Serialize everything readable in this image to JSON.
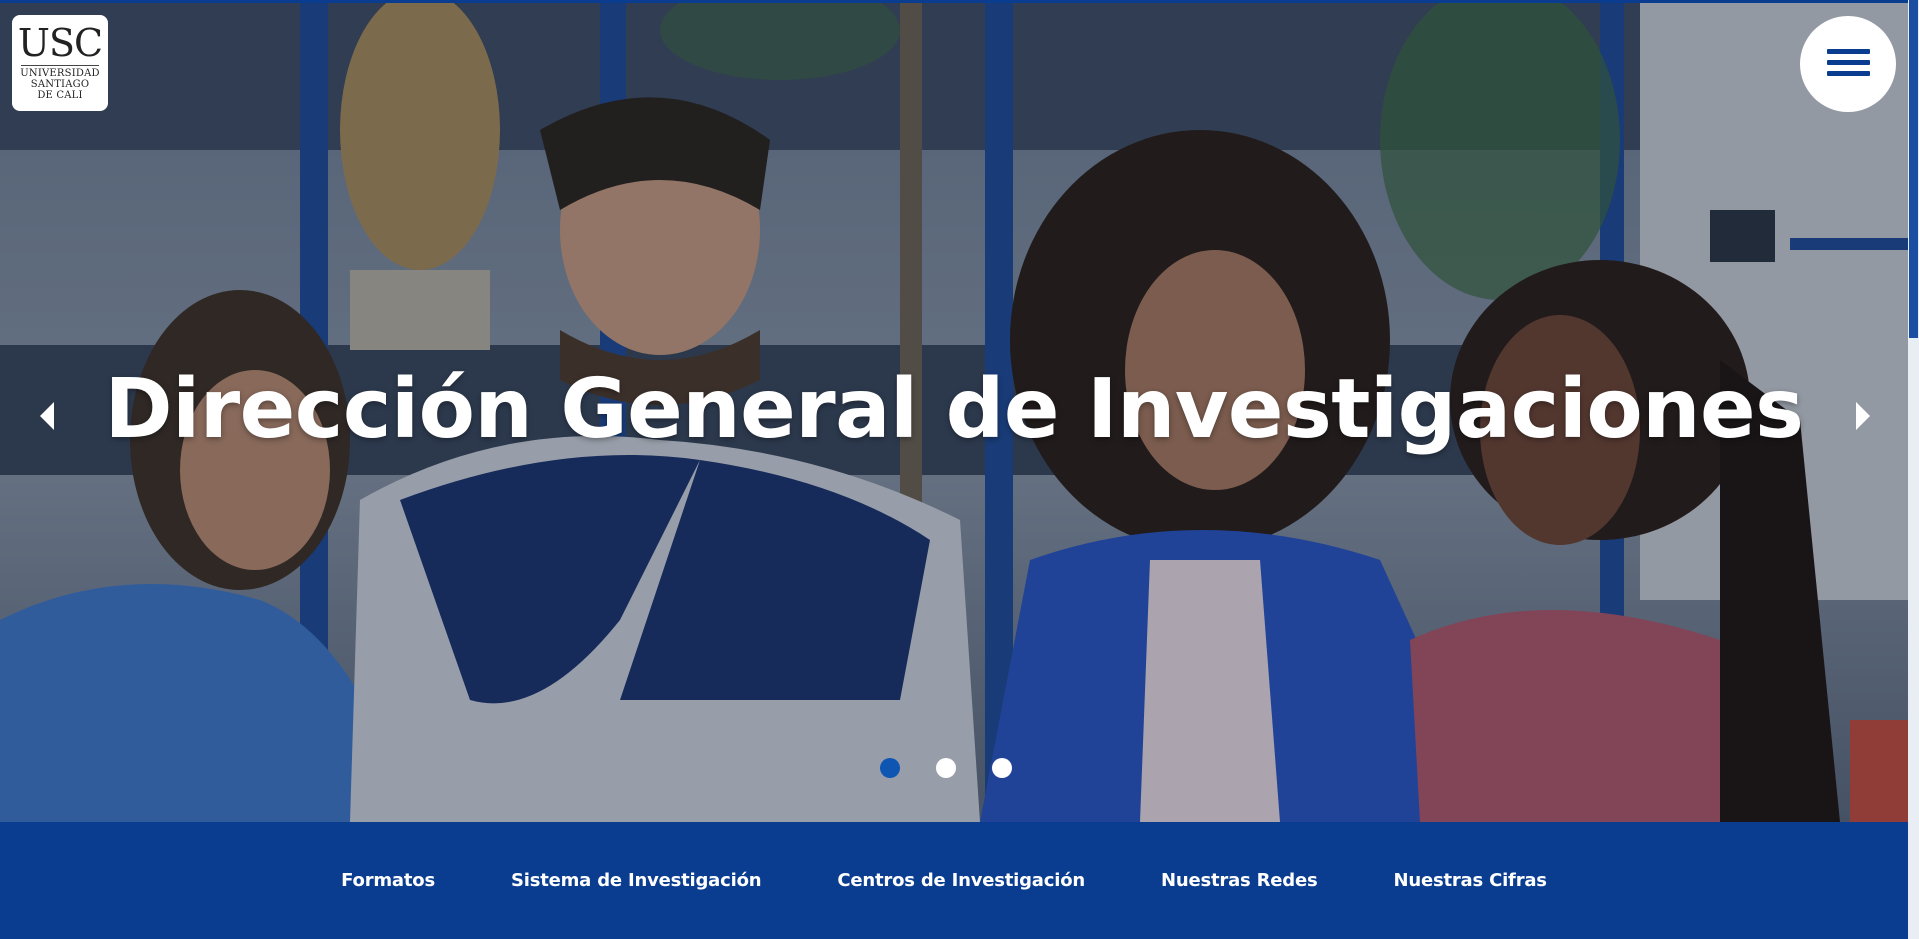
{
  "logo": {
    "abbr": "USC",
    "lines": [
      "UNIVERSIDAD",
      "SANTIAGO",
      "DE   CALI"
    ]
  },
  "menu": {
    "icon": "hamburger-icon"
  },
  "hero": {
    "title": "Dirección General de Investigaciones",
    "prev_icon": "arrow-left-icon",
    "next_icon": "arrow-right-icon",
    "slides": {
      "count": 3,
      "active_index": 0
    }
  },
  "nav": {
    "items": [
      {
        "label": "Formatos"
      },
      {
        "label": "Sistema de Investigación"
      },
      {
        "label": "Centros de Investigación"
      },
      {
        "label": "Nuestras Redes"
      },
      {
        "label": "Nuestras Cifras"
      }
    ]
  },
  "colors": {
    "brand_blue": "#0a3d8f",
    "dot_active": "#0f56b3",
    "text_white": "#ffffff"
  }
}
